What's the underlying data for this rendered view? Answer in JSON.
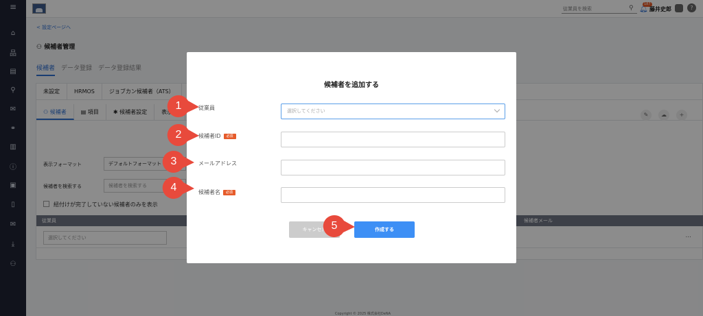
{
  "sidebar": {
    "menu_icon": "≡",
    "items": [
      {
        "icon": "home-icon",
        "glyph": "⌂"
      },
      {
        "icon": "org-chart-icon",
        "glyph": "品"
      },
      {
        "icon": "document-icon",
        "glyph": "▤"
      },
      {
        "icon": "search-icon",
        "glyph": "⚲"
      },
      {
        "icon": "chat-icon",
        "glyph": "✉"
      },
      {
        "icon": "link-icon",
        "glyph": "⚭"
      },
      {
        "icon": "chart-icon",
        "glyph": "▥"
      },
      {
        "icon": "info-icon",
        "glyph": "ⓘ"
      },
      {
        "icon": "id-card-icon",
        "glyph": "▣"
      },
      {
        "icon": "book-icon",
        "glyph": "▯"
      },
      {
        "icon": "mail-icon",
        "glyph": "✉"
      },
      {
        "icon": "download-icon",
        "glyph": "⤓"
      },
      {
        "icon": "user-settings-icon",
        "glyph": "⚇"
      }
    ]
  },
  "topbar": {
    "search_placeholder": "従業員を検索",
    "notification_count": "187",
    "user_name": "藤井史郎",
    "help": "?"
  },
  "page": {
    "back_link": "< 設定ページへ",
    "title": "候補者管理",
    "tabs": [
      "候補者",
      "データ登録",
      "データ登録結果"
    ],
    "source_tabs": [
      "未設定",
      "HRMOS",
      "ジョブカン候補者（ATS）"
    ],
    "sub_tabs": [
      "候補者",
      "項目",
      "候補者設定",
      "表示フ"
    ],
    "filters": {
      "format_label": "表示フォーマット",
      "format_value": "デフォルトフォーマット",
      "search_label": "候補者を検索する",
      "search_placeholder": "候補者を検索する",
      "checkbox_label": "紐付けが完了していない候補者のみを表示"
    },
    "grid": {
      "col_left": "従業員",
      "col_right": "候補者メール",
      "row_select_placeholder": "選択してください",
      "row_more": "..."
    },
    "footer": "Copyright © 2025 株式会社DeNA"
  },
  "modal": {
    "title": "候補者を追加する",
    "fields": [
      {
        "label": "従業員",
        "required": false,
        "placeholder": "選択してください"
      },
      {
        "label": "候補者ID",
        "required": true
      },
      {
        "label": "メールアドレス",
        "required": false
      },
      {
        "label": "候補者名",
        "required": true
      }
    ],
    "required_badge": "必須",
    "cancel_label": "キャンセル",
    "create_label": "作成する"
  },
  "callouts": [
    "1",
    "2",
    "3",
    "4",
    "5"
  ],
  "colors": {
    "accent": "#2f6fcf",
    "primary_button": "#3d8ff5",
    "required_badge": "#e65b2a",
    "callout": "#e84a3c",
    "sidebar": "#1f2433"
  }
}
